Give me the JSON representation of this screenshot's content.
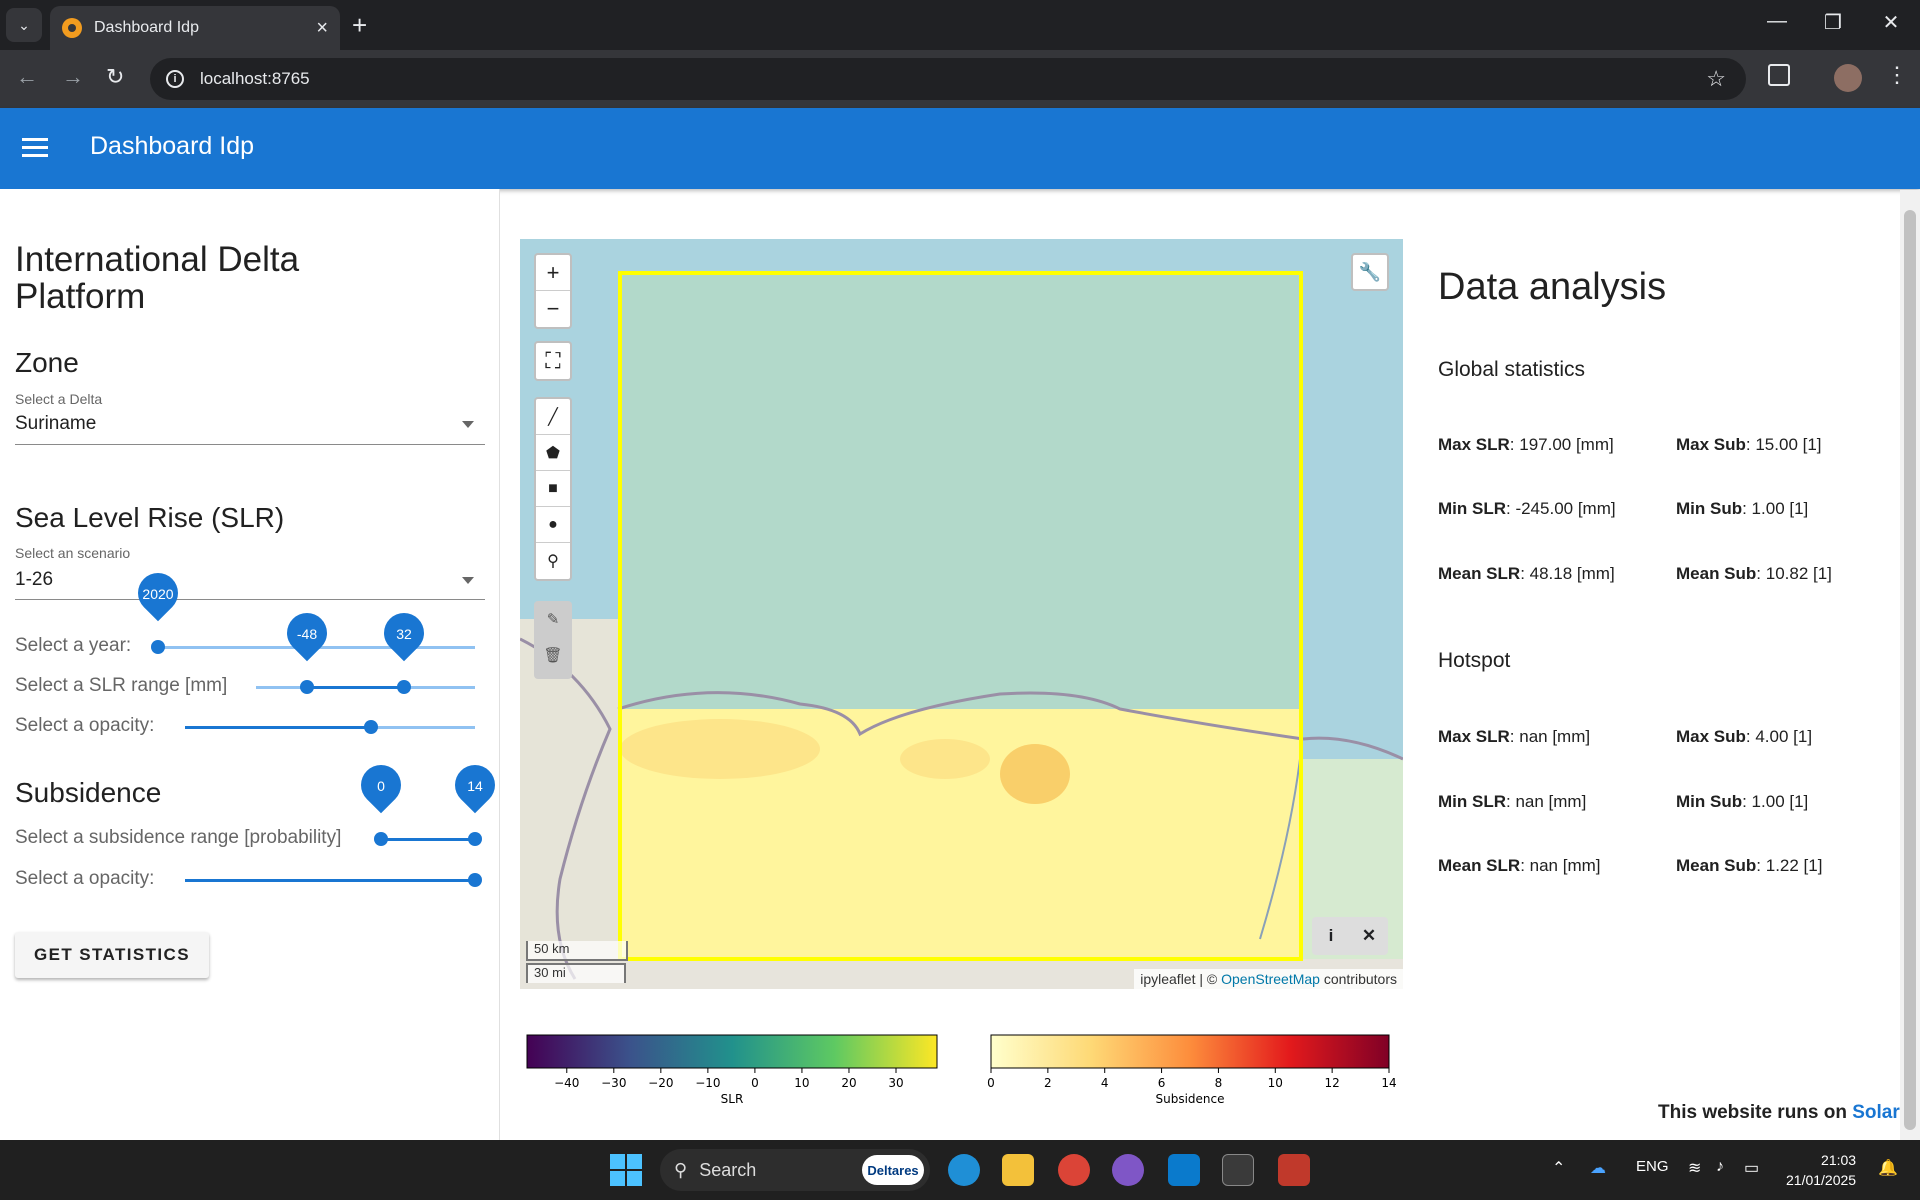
{
  "browser": {
    "tab_title": "Dashboard Idp",
    "url": "localhost:8765"
  },
  "appbar": {
    "title": "Dashboard Idp"
  },
  "sidebar": {
    "title": "International Delta Platform",
    "zone": {
      "heading": "Zone",
      "select_label": "Select a Delta",
      "select_value": "Suriname"
    },
    "slr": {
      "heading": "Sea Level Rise (SLR)",
      "select_label": "Select an scenario",
      "select_value": "1-26",
      "year_label": "Select a year:",
      "year_value": "2020",
      "year_fraction": 0.0,
      "range_label": "Select a SLR range [mm]",
      "range_min": "-48",
      "range_max": "32",
      "opacity_label": "Select a opacity:",
      "opacity_fraction": 0.64
    },
    "subsidence": {
      "heading": "Subsidence",
      "range_label": "Select a subsidence range [probability]",
      "range_min": "0",
      "range_max": "14",
      "opacity_label": "Select a opacity:",
      "opacity_fraction": 1.0
    },
    "button_label": "GET STATISTICS"
  },
  "map": {
    "scale_km": "50 km",
    "scale_mi": "30 mi",
    "attribution_prefix": "ipyleaflet | ©",
    "attribution_link": "OpenStreetMap",
    "attribution_suffix": "contributors",
    "bbox_color": "#ffff00"
  },
  "colorbars": {
    "slr": {
      "label": "SLR",
      "ticks": [
        "−40",
        "−30",
        "−20",
        "−10",
        "0",
        "10",
        "20",
        "30"
      ]
    },
    "subsidence": {
      "label": "Subsidence",
      "ticks": [
        "0",
        "2",
        "4",
        "6",
        "8",
        "10",
        "12",
        "14"
      ]
    }
  },
  "analysis": {
    "title": "Data analysis",
    "global_heading": "Global statistics",
    "global": {
      "max_slr_label": "Max SLR",
      "max_slr_value": ": 197.00 [mm]",
      "max_sub_label": "Max Sub",
      "max_sub_value": ": 15.00 [1]",
      "min_slr_label": "Min SLR",
      "min_slr_value": ": -245.00 [mm]",
      "min_sub_label": "Min Sub",
      "min_sub_value": ": 1.00 [1]",
      "mean_slr_label": "Mean SLR",
      "mean_slr_value": ": 48.18 [mm]",
      "mean_sub_label": "Mean Sub",
      "mean_sub_value": ": 10.82 [1]"
    },
    "hotspot_heading": "Hotspot",
    "hotspot": {
      "max_slr_label": "Max SLR",
      "max_slr_value": ": nan [mm]",
      "max_sub_label": "Max Sub",
      "max_sub_value": ": 4.00 [1]",
      "min_slr_label": "Min SLR",
      "min_slr_value": ": nan [mm]",
      "min_sub_label": "Min Sub",
      "min_sub_value": ": 1.00 [1]",
      "mean_slr_label": "Mean SLR",
      "mean_slr_value": ": nan [mm]",
      "mean_sub_label": "Mean Sub",
      "mean_sub_value": ": 1.22 [1]"
    }
  },
  "footer": {
    "prefix": "This website runs on ",
    "link": "Solara"
  },
  "taskbar": {
    "search_placeholder": "Search",
    "search_badge": "Deltares",
    "language": "ENG",
    "time": "21:03",
    "date": "21/01/2025"
  },
  "colors": {
    "primary": "#1976d2",
    "track_light": "#90c2f2"
  }
}
